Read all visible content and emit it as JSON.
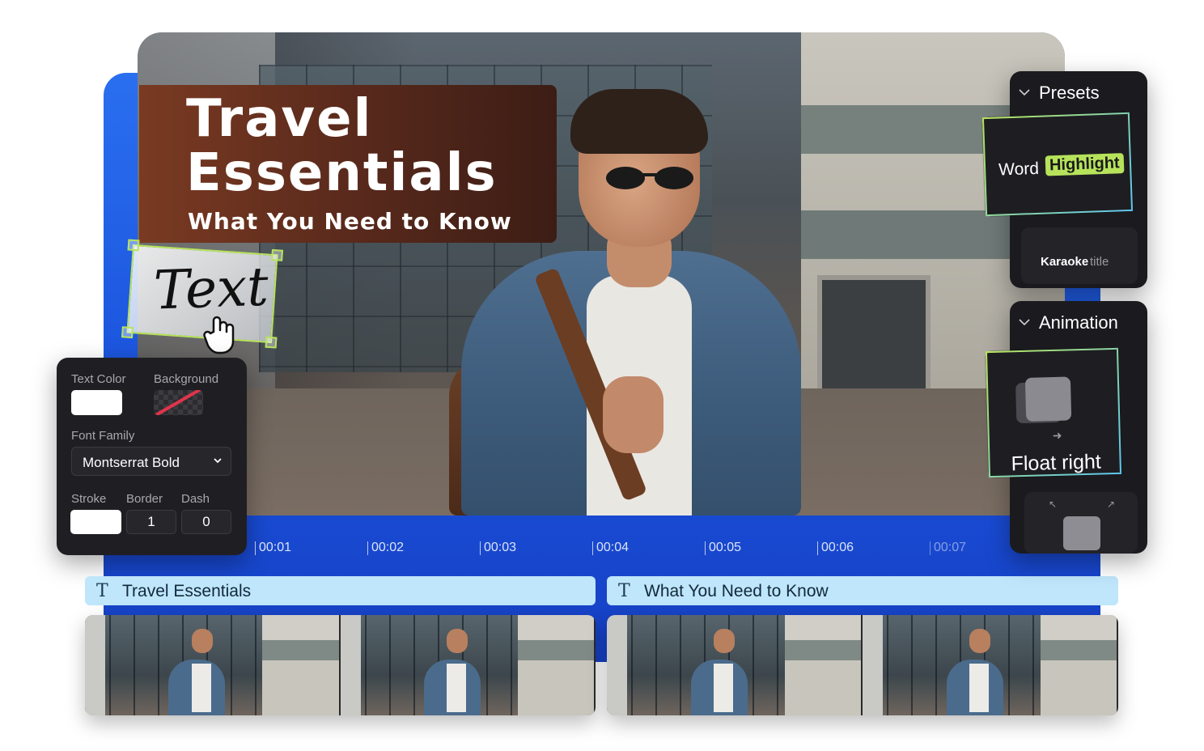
{
  "video": {
    "title_line1": "Travel",
    "title_line2": "Essentials",
    "subtitle": "What You Need to Know",
    "selected_text": "Text"
  },
  "text_properties": {
    "text_color_label": "Text Color",
    "text_color_value": "#ffffff",
    "background_label": "Background",
    "font_family_label": "Font Family",
    "font_family_value": "Montserrat Bold",
    "stroke_label": "Stroke",
    "border_label": "Border",
    "border_value": "1",
    "dash_label": "Dash",
    "dash_value": "0"
  },
  "timeline": {
    "ticks": [
      "00:01",
      "00:02",
      "00:03",
      "00:04",
      "00:05",
      "00:06",
      "00:07"
    ],
    "text_tracks": [
      {
        "icon": "text-icon",
        "label": "Travel Essentials"
      },
      {
        "icon": "text-icon",
        "label": "What You Need to Know"
      }
    ]
  },
  "presets": {
    "header": "Presets",
    "card1_word": "Word",
    "card1_highlight": "Highlight",
    "card2_bold": "Karaoke",
    "card2_light": "title"
  },
  "animation": {
    "header": "Animation",
    "card1_label": "Float right"
  },
  "colors": {
    "accent_blue": "#1f5be0",
    "highlight_green": "#b7e35b",
    "track_blue": "#bfe6fb",
    "panel_dark": "#1f1f23"
  }
}
